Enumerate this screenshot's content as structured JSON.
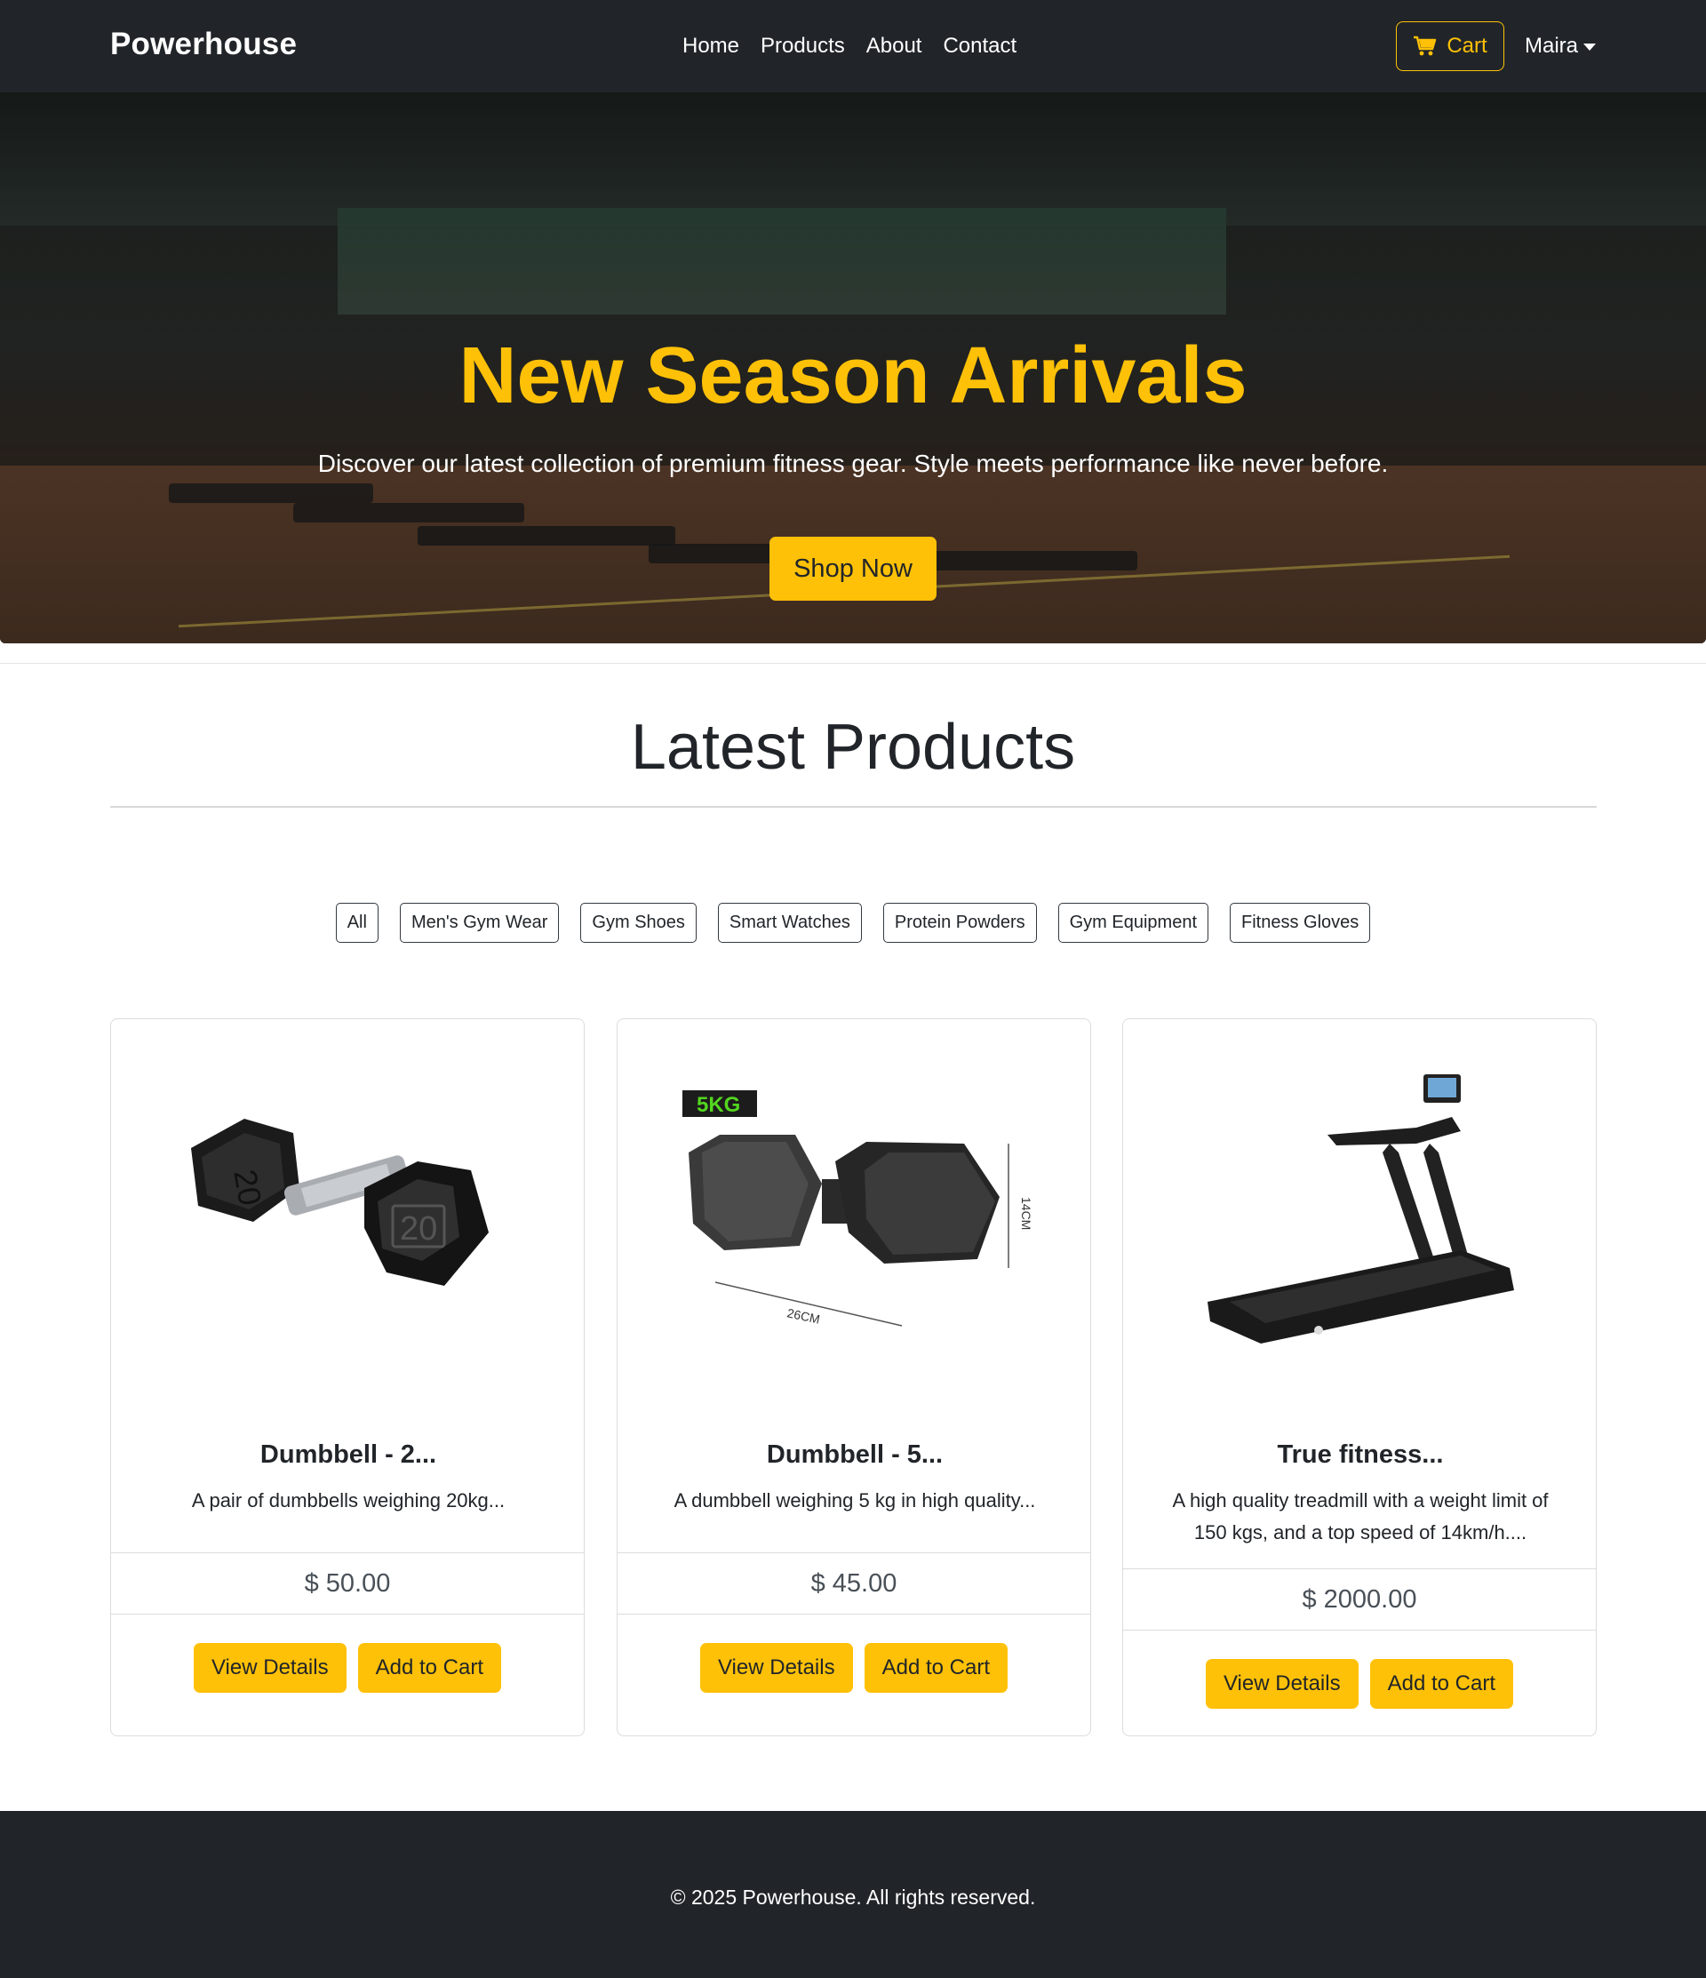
{
  "navbar": {
    "brand": "Powerhouse",
    "links": [
      "Home",
      "Products",
      "About",
      "Contact"
    ],
    "cart_label": "Cart",
    "user_name": "Maira"
  },
  "hero": {
    "title": "New Season Arrivals",
    "subtitle": "Discover our latest collection of premium fitness gear. Style meets performance like never before.",
    "cta_label": "Shop Now"
  },
  "products_section": {
    "title": "Latest Products",
    "filters": [
      "All",
      "Men's Gym Wear",
      "Gym Shoes",
      "Smart Watches",
      "Protein Powders",
      "Gym Equipment",
      "Fitness Gloves"
    ],
    "cards": [
      {
        "image": "dumbbell-20kg-image",
        "title": "Dumbbell - 2...",
        "description": "A pair of dumbbells weighing 20kg...",
        "price": "$ 50.00",
        "view_label": "View Details",
        "add_label": "Add to Cart"
      },
      {
        "image": "dumbbell-5kg-image",
        "image_badge": "5KG",
        "image_dim_width": "26CM",
        "image_dim_height": "14CM",
        "title": "Dumbbell - 5...",
        "description": "A dumbbell weighing 5 kg in high quality...",
        "price": "$ 45.00",
        "view_label": "View Details",
        "add_label": "Add to Cart"
      },
      {
        "image": "treadmill-image",
        "title": "True fitness...",
        "description": "A high quality treadmill with a weight limit of 150 kgs, and a top speed of 14km/h....",
        "price": "$ 2000.00",
        "view_label": "View Details",
        "add_label": "Add to Cart"
      }
    ]
  },
  "footer": {
    "text": "© 2025 Powerhouse. All rights reserved."
  },
  "colors": {
    "accent": "#ffc107",
    "dark": "#212529"
  }
}
